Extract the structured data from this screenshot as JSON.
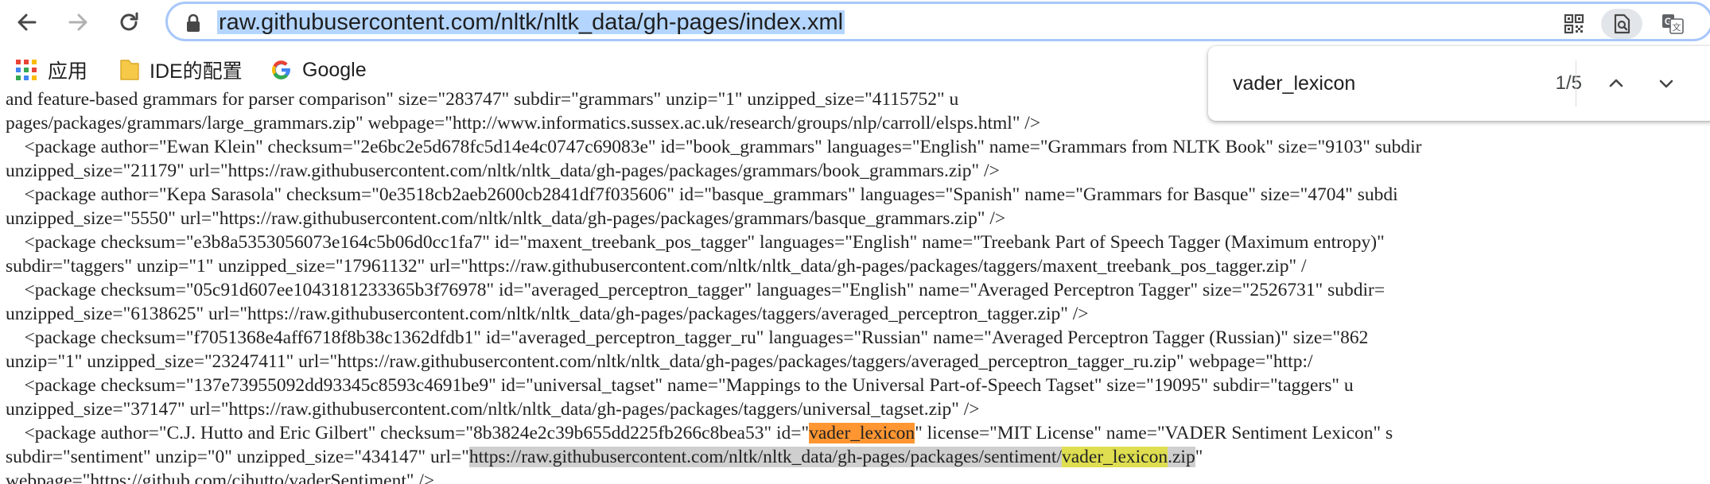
{
  "address_bar": {
    "url": "raw.githubusercontent.com/nltk/nltk_data/gh-pages/index.xml"
  },
  "bookmarks": [
    {
      "label": "应用",
      "icon": "apps-grid-icon"
    },
    {
      "label": "IDE的配置",
      "icon": "folder-icon"
    },
    {
      "label": "Google",
      "icon": "google-logo-icon"
    }
  ],
  "find_bar": {
    "query": "vader_lexicon",
    "count": "1/5"
  },
  "xml": {
    "lines": [
      "and feature-based grammars for parser comparison\" size=\"283747\" subdir=\"grammars\" unzip=\"1\" unzipped_size=\"4115752\" u",
      "pages/packages/grammars/large_grammars.zip\" webpage=\"http://www.informatics.sussex.ac.uk/research/groups/nlp/carroll/elsps.html\" />",
      "    <package author=\"Ewan Klein\" checksum=\"2e6bc2e5d678fc5d14e4c0747c69083e\" id=\"book_grammars\" languages=\"English\" name=\"Grammars from NLTK Book\" size=\"9103\" subdir",
      "unzipped_size=\"21179\" url=\"https://raw.githubusercontent.com/nltk/nltk_data/gh-pages/packages/grammars/book_grammars.zip\" />",
      "    <package author=\"Kepa Sarasola\" checksum=\"0e3518cb2aeb2600cb2841df7f035606\" id=\"basque_grammars\" languages=\"Spanish\" name=\"Grammars for Basque\" size=\"4704\" subdi",
      "unzipped_size=\"5550\" url=\"https://raw.githubusercontent.com/nltk/nltk_data/gh-pages/packages/grammars/basque_grammars.zip\" />",
      "    <package checksum=\"e3b8a5353056073e164c5b06d0cc1fa7\" id=\"maxent_treebank_pos_tagger\" languages=\"English\" name=\"Treebank Part of Speech Tagger (Maximum entropy)\"",
      "subdir=\"taggers\" unzip=\"1\" unzipped_size=\"17961132\" url=\"https://raw.githubusercontent.com/nltk/nltk_data/gh-pages/packages/taggers/maxent_treebank_pos_tagger.zip\" /",
      "    <package checksum=\"05c91d607ee1043181233365b3f76978\" id=\"averaged_perceptron_tagger\" languages=\"English\" name=\"Averaged Perceptron Tagger\" size=\"2526731\" subdir=",
      "unzipped_size=\"6138625\" url=\"https://raw.githubusercontent.com/nltk/nltk_data/gh-pages/packages/taggers/averaged_perceptron_tagger.zip\" />",
      "    <package checksum=\"f7051368e4aff6718f8b38c1362dfdb1\" id=\"averaged_perceptron_tagger_ru\" languages=\"Russian\" name=\"Averaged Perceptron Tagger (Russian)\" size=\"862",
      "unzip=\"1\" unzipped_size=\"23247411\" url=\"https://raw.githubusercontent.com/nltk/nltk_data/gh-pages/packages/taggers/averaged_perceptron_tagger_ru.zip\" webpage=\"http:/",
      "    <package checksum=\"137e73955092dd93345c8593c4691be9\" id=\"universal_tagset\" name=\"Mappings to the Universal Part-of-Speech Tagset\" size=\"19095\" subdir=\"taggers\" u",
      "unzipped_size=\"37147\" url=\"https://raw.githubusercontent.com/nltk/nltk_data/gh-pages/packages/taggers/universal_tagset.zip\" />"
    ],
    "line_vader_1": {
      "a": "    <package author=\"C.J. Hutto and Eric Gilbert\" checksum=\"8b3824e2c39b655dd225fb266c8bea53\" id=\"",
      "match": "vader_lexicon",
      "b": "\" license=\"MIT License\" name=\"VADER Sentiment Lexicon\" s"
    },
    "line_vader_2": {
      "a": "subdir=\"sentiment\" unzip=\"0\" unzipped_size=\"434147\" url=\"",
      "link_a": "https://raw.githubusercontent.com/nltk/nltk_data/gh-pages/packages/sentiment/",
      "match": "vader_lexicon",
      "link_b": ".zip",
      "b": "\""
    },
    "line_last": "webpage=\"https://github.com/cjhutto/vaderSentiment\" />"
  }
}
